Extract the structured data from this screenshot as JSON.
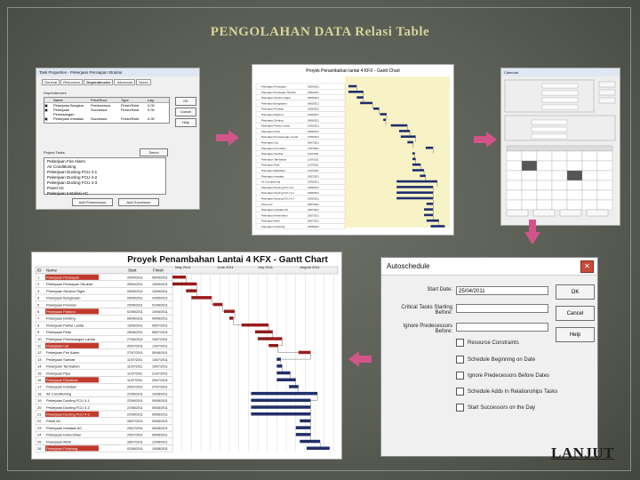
{
  "slide": {
    "title": "PENGOLAHAN DATA Relasi Table",
    "next_link": "LANJUT"
  },
  "task_dialog": {
    "title": "Task Properties - Pekerjaan Persiapan Struktur",
    "tabs": [
      "General",
      "Resources",
      "Dependencies",
      "Advanced",
      "Notes"
    ],
    "section_label": "Dependencies",
    "columns": [
      "Name",
      "Pred/Succ",
      "Type",
      "Lag"
    ],
    "rows": [
      {
        "name": "Pekerjaan Bongkar",
        "rel": "Predecessor",
        "type": "Finish/Start",
        "lag": "0.00"
      },
      {
        "name": "Pekerjaan Pemasangan",
        "rel": "Successor",
        "type": "Finish/Start",
        "lag": "0.00"
      },
      {
        "name": "Pekerjaan Instalasi",
        "rel": "Successor",
        "type": "Finish/Start",
        "lag": "0.00"
      }
    ],
    "buttons": [
      "OK",
      "Cancel",
      "Help"
    ],
    "project_tasks_label": "Project Tasks",
    "select_button": "Select",
    "project_tasks": [
      "Pekerjaan Fire Alarm",
      "Air Conditioning",
      "Pekerjaan Ducting FCU 4-1",
      "Pekerjaan Ducting FCU 4-2",
      "Pekerjaan Ducting FCU 4-3",
      "Panel AC",
      "Pekerjaan Instalasi AC"
    ],
    "bottom_buttons": [
      "Add Predecessor",
      "Add Successor"
    ]
  },
  "mini_gantt": {
    "title": "Proyek Penambahan lantai 4 KFX - Gantt Chart"
  },
  "calendar_dialog": {
    "title": "Calendar"
  },
  "big_gantt": {
    "title": "Proyek Penambahan Lantai 4 KFX - Gantt Chart",
    "columns": [
      "ID",
      "Name",
      "Start",
      "Finish"
    ],
    "months": [
      "May 2011",
      "June 2011",
      "July 2011",
      "August 2011"
    ],
    "rows": [
      {
        "id": "1",
        "name": "Pekerjaan Persiapan",
        "start": "25/04/2011",
        "finish": "05/05/2011"
      },
      {
        "id": "2",
        "name": "Pekerjaan Persiapan Struktur",
        "start": "25/04/2011",
        "finish": "13/05/2011"
      },
      {
        "id": "3",
        "name": "Pekerjaan Struktur Rigid",
        "start": "05/05/2011",
        "finish": "13/05/2011"
      },
      {
        "id": "4",
        "name": "Pekerjaan Bongkaran",
        "start": "09/05/2011",
        "finish": "24/05/2011"
      },
      {
        "id": "5",
        "name": "Pekerjaan Pondasi",
        "start": "25/05/2011",
        "finish": "01/06/2011"
      },
      {
        "id": "6",
        "name": "Pekerjaan Plafond",
        "start": "02/06/2011",
        "finish": "10/06/2011"
      },
      {
        "id": "7",
        "name": "Pekerjaan Dinding",
        "start": "06/06/2011",
        "finish": "09/06/2011"
      },
      {
        "id": "8",
        "name": "Pekerjaan Partisi Lantai",
        "start": "15/06/2011",
        "finish": "05/07/2011"
      },
      {
        "id": "9",
        "name": "Pekerjaan Pintu",
        "start": "25/06/2011",
        "finish": "08/07/2011"
      },
      {
        "id": "10",
        "name": "Pekerjaan Pemasangan Lantai",
        "start": "27/06/2011",
        "finish": "15/07/2011"
      },
      {
        "id": "11",
        "name": "Pekerjaan Cat",
        "start": "05/07/2011",
        "finish": "12/07/2011"
      },
      {
        "id": "12",
        "name": "Pekerjaan Fire Alarm",
        "start": "27/07/2011",
        "finish": "05/08/2011"
      },
      {
        "id": "13",
        "name": "Pekerjaan Sanitair",
        "start": "11/07/2011",
        "finish": "14/07/2011"
      },
      {
        "id": "14",
        "name": "Pekerjaan Tambahan",
        "start": "11/07/2011",
        "finish": "15/07/2011"
      },
      {
        "id": "15",
        "name": "Pekerjaan Pipa",
        "start": "11/07/2011",
        "finish": "21/07/2011"
      },
      {
        "id": "16",
        "name": "Pekerjaan Elektrikal",
        "start": "11/07/2011",
        "finish": "25/07/2011"
      },
      {
        "id": "17",
        "name": "Pekerjaan Instalasi",
        "start": "20/07/2011",
        "finish": "27/07/2011"
      },
      {
        "id": "18",
        "name": "Air Conditioning",
        "start": "22/06/2011",
        "finish": "10/08/2011"
      },
      {
        "id": "19",
        "name": "Pekerjaan Ducting FCU 4-1",
        "start": "22/06/2011",
        "finish": "05/08/2011"
      },
      {
        "id": "20",
        "name": "Pekerjaan Ducting FCU 4-2",
        "start": "22/06/2011",
        "finish": "05/08/2011"
      },
      {
        "id": "21",
        "name": "Pekerjaan Ducting FCU 4-3",
        "start": "22/06/2011",
        "finish": "05/08/2011"
      },
      {
        "id": "22",
        "name": "Panel AC",
        "start": "28/07/2011",
        "finish": "05/08/2011"
      },
      {
        "id": "23",
        "name": "Pekerjaan Instalasi AC",
        "start": "25/07/2011",
        "finish": "05/08/2011"
      },
      {
        "id": "24",
        "name": "Pekerjaan Kebersihan",
        "start": "25/07/2011",
        "finish": "05/08/2011"
      },
      {
        "id": "25",
        "name": "Pekerjaan Akhir",
        "start": "28/07/2011",
        "finish": "12/08/2011"
      },
      {
        "id": "26",
        "name": "Pekerjaan Finishing",
        "start": "02/08/2011",
        "finish": "19/08/2011"
      }
    ]
  },
  "autoschedule_dialog": {
    "title": "Autoschedule",
    "start_date_label": "Start Date:",
    "start_date_value": "25/04/2011",
    "field2_label": "Critical Tasks Starting Before:",
    "field3_label": "Ignore Predecessors Before:",
    "buttons": [
      "OK",
      "Cancel",
      "Help"
    ],
    "checkboxes": [
      "Resource Constraints",
      "Schedule Beginning on Date",
      "Ignore Predecessors Before Dates",
      "Schedule Adds In Relationships Tasks",
      "Start Successors on the Day"
    ]
  },
  "colors": {
    "bar_critical": "#9b1b1b",
    "bar_normal": "#1f2e6e",
    "row_highlight": "#c0392b",
    "arrow": "#d2558a"
  }
}
